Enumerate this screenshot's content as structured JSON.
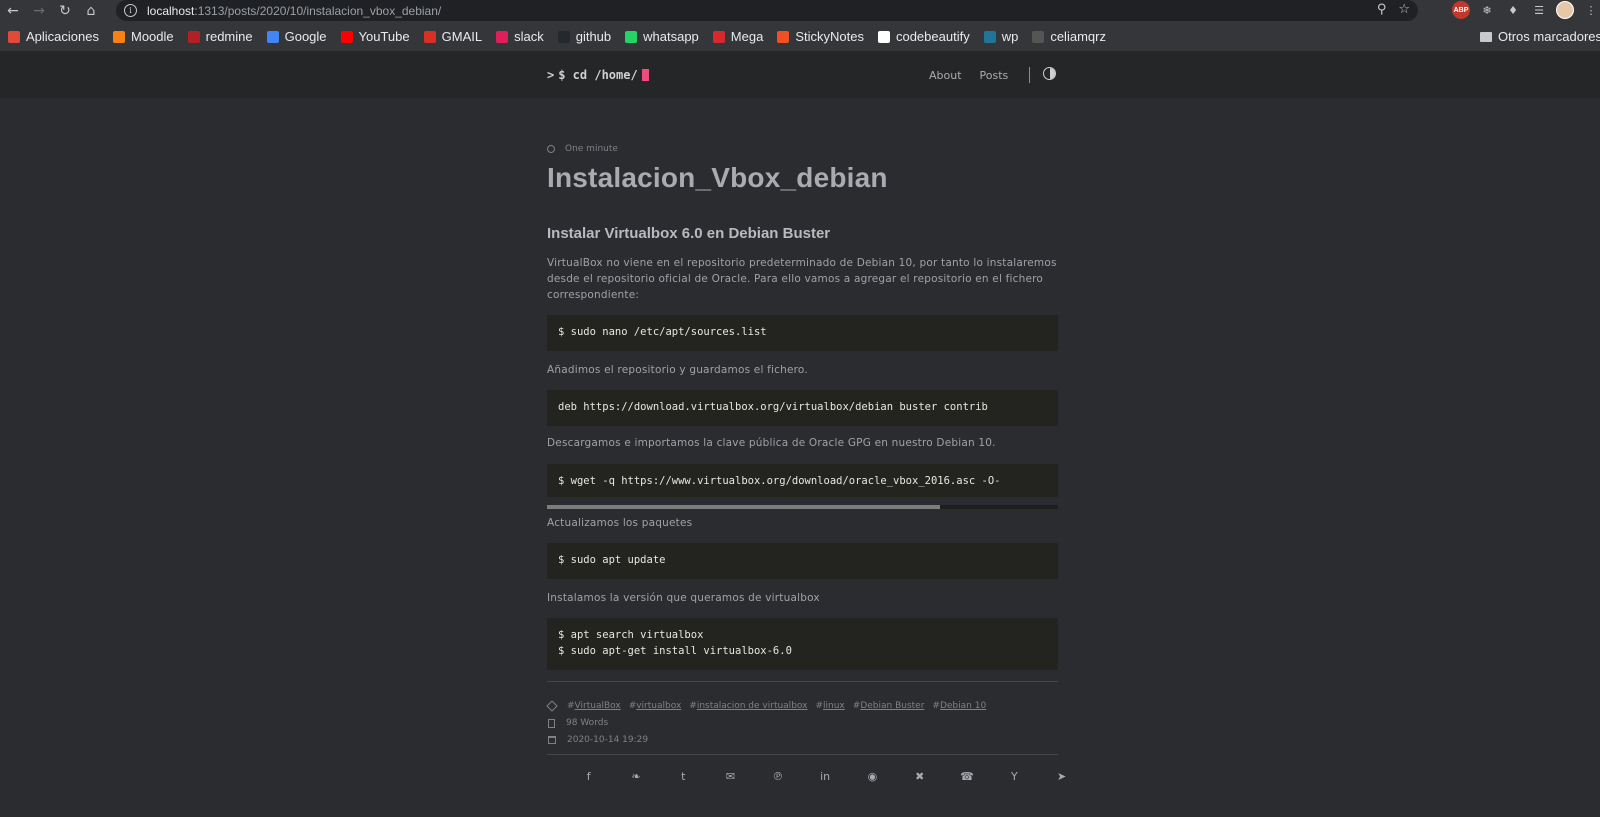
{
  "browser": {
    "url_host": "localhost",
    "url_path": ":1313/posts/2020/10/instalacion_vbox_debian/",
    "bookmarks": [
      {
        "label": "Aplicaciones",
        "icon": "apps-grid-icon",
        "color": "#e04a3a"
      },
      {
        "label": "Moodle",
        "icon": "moodle-icon",
        "color": "#f98012"
      },
      {
        "label": "redmine",
        "icon": "redmine-icon",
        "color": "#b32024"
      },
      {
        "label": "Google",
        "icon": "google-icon",
        "color": "#4285f4"
      },
      {
        "label": "YouTube",
        "icon": "youtube-icon",
        "color": "#ff0000"
      },
      {
        "label": "GMAIL",
        "icon": "gmail-icon",
        "color": "#d93025"
      },
      {
        "label": "slack",
        "icon": "slack-icon",
        "color": "#e01e5a"
      },
      {
        "label": "github",
        "icon": "github-icon",
        "color": "#24292e"
      },
      {
        "label": "whatsapp",
        "icon": "whatsapp-icon",
        "color": "#25d366"
      },
      {
        "label": "Mega",
        "icon": "mega-icon",
        "color": "#d9272e"
      },
      {
        "label": "StickyNotes",
        "icon": "stickynotes-icon",
        "color": "#f25022"
      },
      {
        "label": "codebeautify",
        "icon": "codebeautify-icon",
        "color": "#ffffff"
      },
      {
        "label": "wp",
        "icon": "wordpress-icon",
        "color": "#21759b"
      },
      {
        "label": "celiamqrz",
        "icon": "profile-icon",
        "color": "#555555"
      }
    ],
    "other_bookmarks": "Otros marcadores"
  },
  "site": {
    "logo": "$ cd /home/",
    "logo_prompt": ">",
    "nav": [
      "About",
      "Posts"
    ],
    "accent": "#ee4c7c"
  },
  "post": {
    "reading_time": "One minute",
    "title": "Instalacion_Vbox_debian",
    "subtitle": "Instalar Virtualbox 6.0 en Debian Buster",
    "p1": "VirtualBox no viene en el repositorio predeterminado de Debian 10, por tanto lo instalaremos desde el repositorio oficial de Oracle. Para ello vamos a agregar el repositorio en el fichero correspondiente:",
    "code1": "$ sudo nano /etc/apt/sources.list",
    "p2": "Añadimos el repositorio y guardamos el fichero.",
    "code2": "deb https://download.virtualbox.org/virtualbox/debian buster contrib",
    "p3": "Descargamos e importamos la clave pública de Oracle GPG en nuestro Debian 10.",
    "code3": "$ wget -q https://www.virtualbox.org/download/oracle_vbox_2016.asc -O-",
    "code3_scroll_fraction": 0.77,
    "p4": "Actualizamos los paquetes",
    "code4": "$ sudo apt update",
    "p5": "Instalamos la versión que queramos de virtualbox",
    "code5": "$ apt search virtualbox\n$ sudo apt-get install virtualbox-6.0",
    "tags": [
      "VirtualBox",
      "virtualbox",
      "instalacion de virtualbox",
      "linux",
      "Debian Buster",
      "Debian 10"
    ],
    "words": "98 Words",
    "date": "2020-10-14 19:29",
    "share_icons": [
      "facebook-icon",
      "twitter-icon",
      "tumblr-icon",
      "email-icon",
      "pinterest-icon",
      "linkedin-icon",
      "reddit-icon",
      "xing-icon",
      "whatsapp-icon",
      "hackernews-icon",
      "telegram-icon"
    ]
  }
}
